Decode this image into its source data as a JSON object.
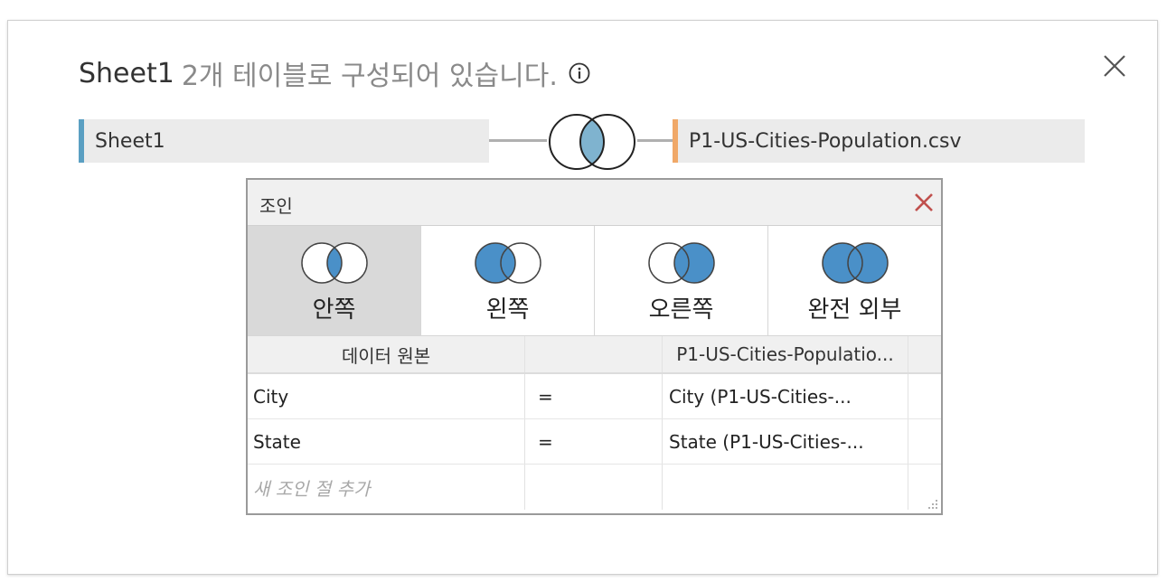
{
  "header": {
    "source_name": "Sheet1",
    "description": "2개 테이블로 구성되어 있습니다.",
    "info_icon": "info-icon",
    "close_icon": "close-icon"
  },
  "tables": {
    "left": {
      "name": "Sheet1",
      "accent_color": "#5a9fc2"
    },
    "right": {
      "name": "P1-US-Cities-Population.csv",
      "accent_color": "#f0a868"
    }
  },
  "join_dialog": {
    "title": "조인",
    "close_icon": "close-icon",
    "close_color": "#c0504d",
    "join_types": [
      {
        "label": "안쪽",
        "icon": "inner-join-icon",
        "selected": true
      },
      {
        "label": "왼쪽",
        "icon": "left-join-icon",
        "selected": false
      },
      {
        "label": "오른쪽",
        "icon": "right-join-icon",
        "selected": false
      },
      {
        "label": "완전 외부",
        "icon": "full-outer-join-icon",
        "selected": false
      }
    ],
    "venn_fill_color": "#4a90c8",
    "clause_headers": {
      "left": "데이터 원본",
      "operator": "",
      "right": "P1-US-Cities-Populatio..."
    },
    "clauses": [
      {
        "left": "City",
        "operator": "=",
        "right": "City (P1-US-Cities-..."
      },
      {
        "left": "State",
        "operator": "=",
        "right": "State (P1-US-Cities-..."
      }
    ],
    "add_clause_placeholder": "새 조인 절 추가"
  }
}
